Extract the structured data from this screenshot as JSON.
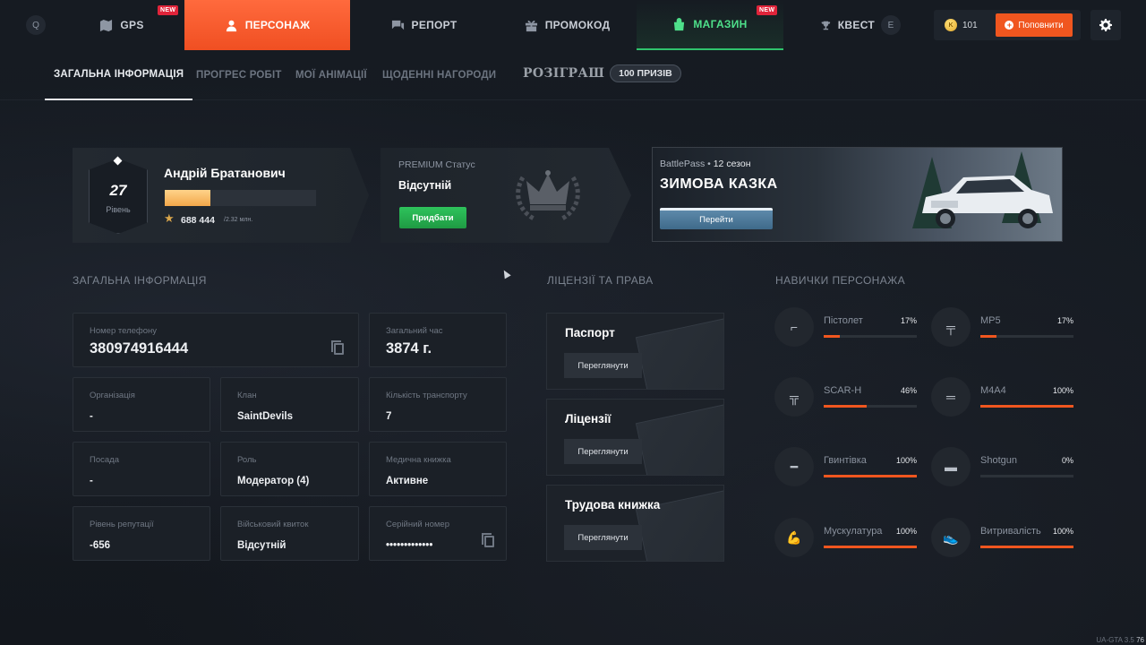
{
  "topbar": {
    "hint_left": "Q",
    "hint_right": "E",
    "tabs": [
      {
        "label": "GPS",
        "badge": "NEW"
      },
      {
        "label": "ПЕРСОНАЖ"
      },
      {
        "label": "РЕПОРТ"
      },
      {
        "label": "ПРОМОКОД"
      },
      {
        "label": "МАГАЗИН",
        "badge": "NEW"
      },
      {
        "label": "КВЕСТ"
      }
    ],
    "balance": "101",
    "topup_label": "Поповнити",
    "colors": {
      "accent": "#f0561f",
      "shop": "#4ee08a",
      "badge": "#e0243a"
    }
  },
  "subnav": {
    "tabs": [
      "ЗАГАЛЬНА ІНФОРМАЦІЯ",
      "ПРОГРЕС РОБІТ",
      "МОЇ АНІМАЦІЇ",
      "ЩОДЕННІ НАГОРОДИ"
    ],
    "raffle_title": "РОЗІГРАШ",
    "raffle_pill": "100 ПРИЗІВ"
  },
  "profile": {
    "level": "27",
    "level_caption": "Рівень",
    "name": "Андрій Братанович",
    "xp": "688 444",
    "xp_max": "/2.32 млн.",
    "xp_fraction": 0.3
  },
  "premium": {
    "label": "PREMIUM Статус",
    "value": "Відсутній",
    "buy_label": "Придбати"
  },
  "battlepass": {
    "label": "BattlePass",
    "season": "12 сезон",
    "title": "ЗИМОВА КАЗКА",
    "go_label": "Перейти"
  },
  "general": {
    "heading": "ЗАГАЛЬНА ІНФОРМАЦІЯ",
    "phone": {
      "label": "Номер телефону",
      "value": "380974916444"
    },
    "total_time": {
      "label": "Загальний час",
      "value": "3874 г."
    },
    "organization": {
      "label": "Організація",
      "value": "-"
    },
    "clan": {
      "label": "Клан",
      "value": "SaintDevils"
    },
    "vehicles": {
      "label": "Кількість транспорту",
      "value": "7"
    },
    "position": {
      "label": "Посада",
      "value": "-"
    },
    "role": {
      "label": "Роль",
      "value": "Модератор (4)"
    },
    "medbook": {
      "label": "Медична книжка",
      "value": "Активне"
    },
    "reputation": {
      "label": "Рівень репутації",
      "value": "-656"
    },
    "military": {
      "label": "Військовий квиток",
      "value": "Відсутній"
    },
    "serial": {
      "label": "Серійний номер",
      "value": "•••••••••••••"
    }
  },
  "licenses": {
    "heading": "ЛІЦЕНЗІЇ ТА ПРАВА",
    "items": [
      {
        "title": "Паспорт",
        "button": "Переглянути"
      },
      {
        "title": "Ліцензії",
        "button": "Переглянути"
      },
      {
        "title": "Трудова книжка",
        "button": "Переглянути"
      }
    ]
  },
  "skills": {
    "heading": "НАВИЧКИ ПЕРСОНАЖА",
    "items": [
      {
        "name": "Пістолет",
        "pct": "17%",
        "value": 0.17,
        "icon": "pistol-icon"
      },
      {
        "name": "MP5",
        "pct": "17%",
        "value": 0.17,
        "icon": "smg-icon"
      },
      {
        "name": "SCAR-H",
        "pct": "46%",
        "value": 0.46,
        "icon": "scar-icon"
      },
      {
        "name": "M4A4",
        "pct": "100%",
        "value": 1.0,
        "icon": "rifle-icon"
      },
      {
        "name": "Гвинтівка",
        "pct": "100%",
        "value": 1.0,
        "icon": "sniper-icon"
      },
      {
        "name": "Shotgun",
        "pct": "0%",
        "value": 0.0,
        "icon": "shotgun-icon"
      },
      {
        "name": "Мускулатура",
        "pct": "100%",
        "value": 1.0,
        "icon": "muscle-icon"
      },
      {
        "name": "Витривалість",
        "pct": "100%",
        "value": 1.0,
        "icon": "shoe-icon"
      }
    ]
  },
  "footer": {
    "version": "UA-GTA 3.5",
    "fps": "76"
  }
}
